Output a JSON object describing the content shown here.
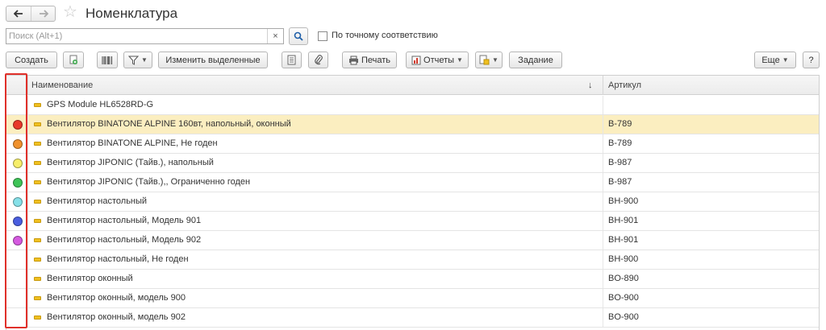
{
  "window": {
    "title": "Номенклатура"
  },
  "search": {
    "placeholder": "Поиск (Alt+1)",
    "value": "",
    "clear_glyph": "×",
    "exact_label": "По точному соответствию"
  },
  "toolbar": {
    "create": "Создать",
    "edit_selected": "Изменить выделенные",
    "print": "Печать",
    "reports": "Отчеты",
    "task": "Задание",
    "more": "Еще",
    "help": "?"
  },
  "table": {
    "columns": {
      "name": "Наименование",
      "article": "Артикул",
      "sort_glyph": "↓"
    },
    "rows": [
      {
        "name": "GPS Module HL6528RD-G",
        "article": "",
        "color": ""
      },
      {
        "name": "Вентилятор BINATONE ALPINE 160вт, напольный, оконный",
        "article": "B-789",
        "color": "#e8392b",
        "selected": true
      },
      {
        "name": "Вентилятор BINATONE ALPINE, Не годен",
        "article": "B-789",
        "color": "#f0922e"
      },
      {
        "name": "Вентилятор JIPONIC (Тайв.), напольный",
        "article": "B-987",
        "color": "#f6ee6a"
      },
      {
        "name": "Вентилятор JIPONIC (Тайв.),, Ограниченно годен",
        "article": "B-987",
        "color": "#3ec457"
      },
      {
        "name": "Вентилятор настольный",
        "article": "BH-900",
        "color": "#86e0e8"
      },
      {
        "name": "Вентилятор настольный, Модель 901",
        "article": "BH-901",
        "color": "#4a5ee0"
      },
      {
        "name": "Вентилятор настольный, Модель 902",
        "article": "BH-901",
        "color": "#d55ae0"
      },
      {
        "name": "Вентилятор настольный, Не годен",
        "article": "BH-900",
        "color": ""
      },
      {
        "name": "Вентилятор оконный",
        "article": "BO-890",
        "color": ""
      },
      {
        "name": "Вентилятор оконный, модель 900",
        "article": "BO-900",
        "color": ""
      },
      {
        "name": "Вентилятор оконный, модель 902",
        "article": "BO-900",
        "color": ""
      }
    ]
  },
  "colors": {
    "highlight_frame": "#e0302a",
    "selected_row": "#fbeec0"
  }
}
